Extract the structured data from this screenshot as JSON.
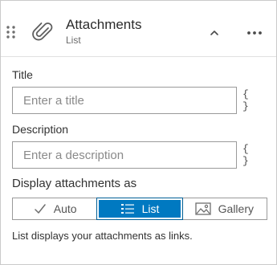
{
  "header": {
    "title": "Attachments",
    "subtitle": "List",
    "icon": "paperclip-icon"
  },
  "form": {
    "title_label": "Title",
    "title_placeholder": "Enter a title",
    "title_value": "",
    "description_label": "Description",
    "description_placeholder": "Enter a description",
    "description_value": "",
    "expression_label": "{ }"
  },
  "display": {
    "label": "Display attachments as",
    "options": [
      {
        "label": "Auto",
        "icon": "checkmark-icon"
      },
      {
        "label": "List",
        "icon": "list-icon"
      },
      {
        "label": "Gallery",
        "icon": "image-icon"
      }
    ],
    "selected": "List",
    "hint": "List displays your attachments as links."
  },
  "colors": {
    "accent": "#0079c1",
    "border": "#9a9a9a",
    "text": "#323232"
  }
}
